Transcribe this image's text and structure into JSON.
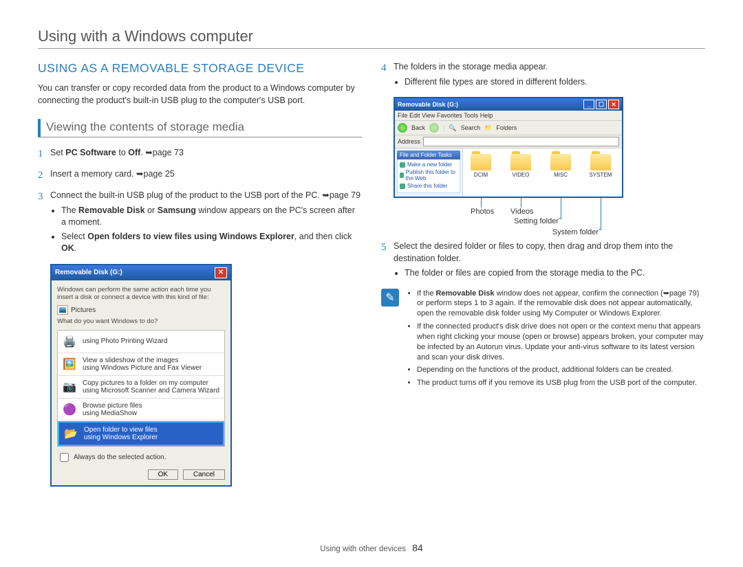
{
  "page_title": "Using with a Windows computer",
  "section_heading": "USING AS A REMOVABLE STORAGE DEVICE",
  "intro": "You can transfer or copy recorded data from the product to a Windows computer by connecting the product's built-in USB plug to the computer's USB port.",
  "sub_heading": "Viewing the contents of storage media",
  "steps_left": {
    "s1_a": "Set ",
    "s1_b": "PC Software",
    "s1_c": " to ",
    "s1_d": "Off",
    "s1_e": ". ➥page 73",
    "s2": "Insert a memory card. ➥page 25",
    "s3": "Connect the built-in USB plug of the product to the USB port of the PC. ➥page 79",
    "s3_b1_a": "The ",
    "s3_b1_b": "Removable Disk",
    "s3_b1_c": " or ",
    "s3_b1_d": "Samsung",
    "s3_b1_e": " window appears on the PC's screen after a moment.",
    "s3_b2_a": "Select ",
    "s3_b2_b": "Open folders to view files using Windows Explorer",
    "s3_b2_c": ", and then click ",
    "s3_b2_d": "OK",
    "s3_b2_e": "."
  },
  "dialog": {
    "title": "Removable Disk (G:)",
    "line1": "Windows can perform the same action each time you insert a disk or connect a device with this kind of file:",
    "pictures": "Pictures",
    "prompt": "What do you want Windows to do?",
    "opt1": "using Photo Printing Wizard",
    "opt2a": "View a slideshow of the images",
    "opt2b": "using Windows Picture and Fax Viewer",
    "opt3a": "Copy pictures to a folder on my computer",
    "opt3b": "using Microsoft Scanner and Camera Wizard",
    "opt4a": "Browse picture files",
    "opt4b": "using MediaShow",
    "opt5a": "Open folder to view files",
    "opt5b": "using Windows Explorer",
    "check": "Always do the selected action.",
    "ok": "OK",
    "cancel": "Cancel"
  },
  "steps_right": {
    "s4": "The folders in the storage media appear.",
    "s4_b1": "Different file types are stored in different folders.",
    "s5": "Select the desired folder or files to copy, then drag and drop them into the destination folder.",
    "s5_b1": "The folder or files are copied from the storage media to the PC."
  },
  "explorer": {
    "title": "Removable Disk (G:)",
    "menu": "File   Edit   View   Favorites   Tools   Help",
    "tool_back": "Back",
    "tool_search": "Search",
    "tool_folders": "Folders",
    "addr": "Address",
    "side_head": "File and Folder Tasks",
    "side1": "Make a new folder",
    "side2": "Publish this folder to the Web",
    "side3": "Share this folder",
    "f1": "DCIM",
    "f2": "VIDEO",
    "f3": "MISC",
    "f4": "SYSTEM"
  },
  "callouts": {
    "photos": "Photos",
    "videos": "Videos",
    "setting": "Setting folder",
    "system": "System folder"
  },
  "notes": {
    "n1_a": "If the ",
    "n1_b": "Removable Disk",
    "n1_c": " window does not appear, confirm the connection (➥page 79) or perform steps 1 to 3 again. If the removable disk does not appear automatically, open the removable disk folder using My Computer or Windows Explorer.",
    "n2": "If the connected product's disk drive does not open or the context menu that appears when right clicking your mouse (open or browse) appears broken, your computer may be infected by an Autorun virus. Update your anti-virus software to its latest version and scan your disk drives.",
    "n3": "Depending on the functions of the product, additional folders can be created.",
    "n4": "The product turns off if you remove its USB plug from the USB port of the computer."
  },
  "footer_label": "Using with other devices",
  "page_number": "84"
}
